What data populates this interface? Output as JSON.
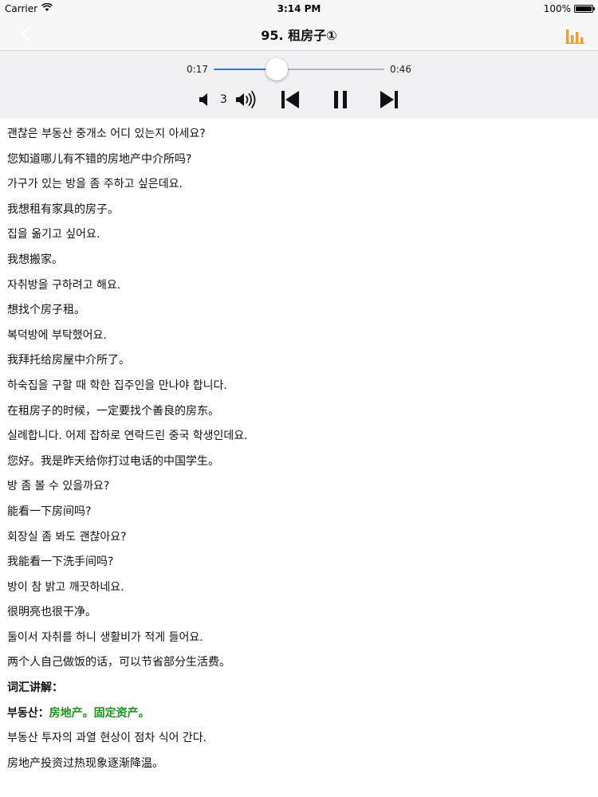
{
  "status": {
    "carrier": "Carrier",
    "time": "3:14 PM",
    "battery": "100%",
    "battery_level": 1.0
  },
  "nav": {
    "title": "95. 租房子①",
    "accent_color": "#f0a030"
  },
  "player": {
    "current_time": "0:17",
    "total_time": "0:46",
    "progress": 0.37,
    "volume": "3",
    "accent_color": "#1a7fd4"
  },
  "lines": [
    "괜찮은 부동산 중개소 어디 있는지 아세요?",
    "您知道哪儿有不错的房地产中介所吗?",
    "가구가 있는 방을 좀 주하고 싶은데요.",
    "我想租有家具的房子。",
    "집을 옮기고 싶어요.",
    "我想搬家。",
    "자취방을 구하려고 해요.",
    "想找个房子租。",
    "복덕방에 부탁했어요.",
    "我拜托给房屋中介所了。",
    "하숙집을 구할 때 학한 집주인을 만나야 합니다.",
    "在租房子的时候，一定要找个善良的房东。",
    "실례합니다. 어제 잡하로 연락드린 중국 학생인데요.",
    "您好。我是昨天给你打过电话的中国学生。",
    "방 좀 볼 수 있을까요?",
    "能看一下房间吗?",
    "회장실 좀 봐도 괜찮아요?",
    "我能看一下洗手间吗?",
    "방이 참 밝고 깨끗하네요.",
    "很明亮也很干净。",
    "둘이서 자취를 하니 생활비가 적게 들어요.",
    "两个人自己做饭的话，可以节省部分生活费。"
  ],
  "vocab": {
    "heading": "词汇讲解：",
    "term": "부동산：",
    "definition": "房地产。固定资产。",
    "example_ko": "부동산 투자의 과열 현상이 점차 식어 간다.",
    "example_zh": "房地产投资过热现象逐渐降温。"
  }
}
